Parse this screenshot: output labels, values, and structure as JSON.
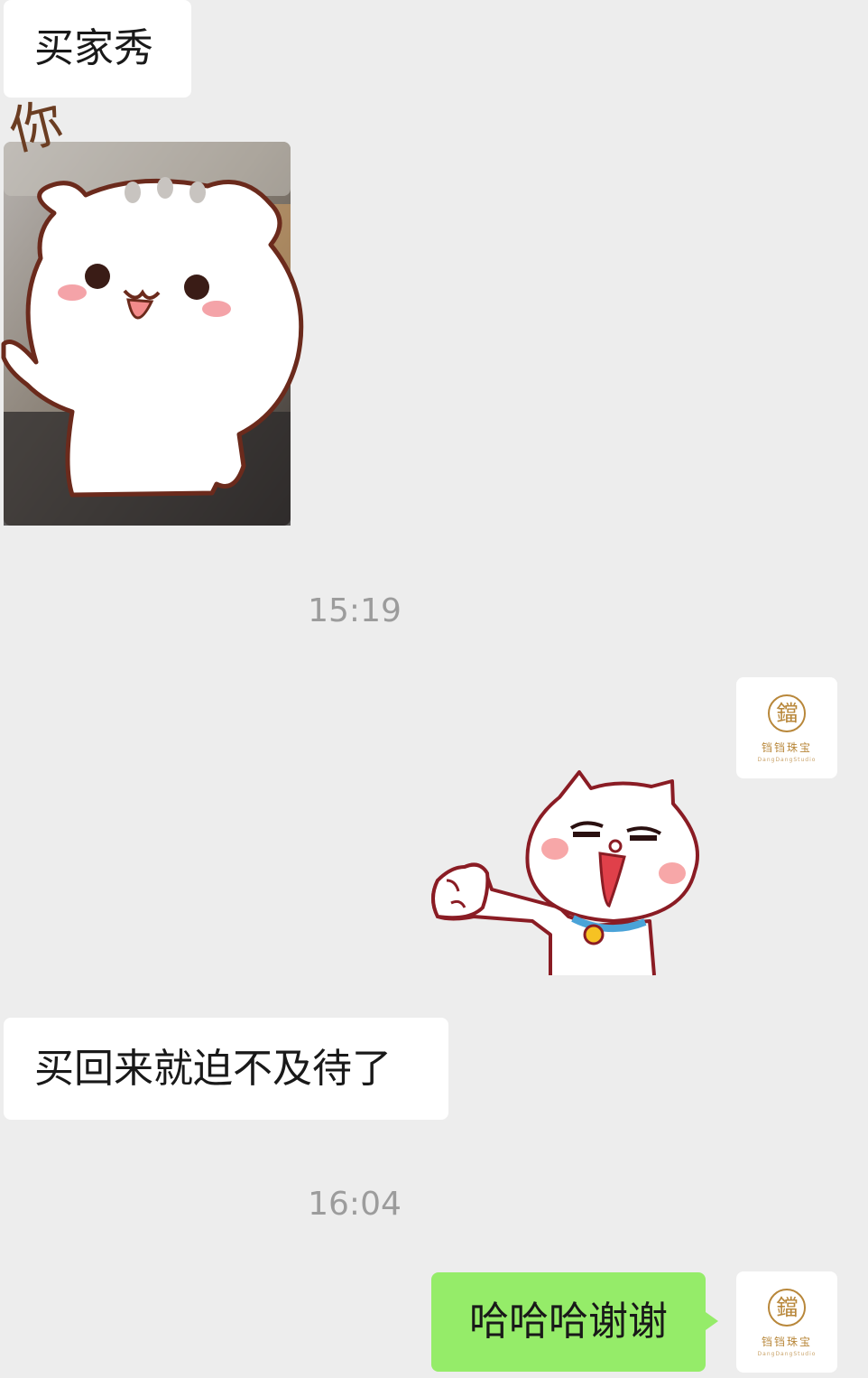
{
  "messages": {
    "left_1": "买家秀",
    "left_2": "买回来就迫不及待了",
    "right_1": "哈哈哈谢谢"
  },
  "timestamps": {
    "t1": "15:19",
    "t2": "16:04"
  },
  "sticker_text": "你",
  "avatar": {
    "brand": "铛铛珠宝",
    "brand_en": "DangDangStudio",
    "logo_glyph": "鐺"
  },
  "colors": {
    "background": "#ededed",
    "left_bubble": "#ffffff",
    "right_bubble": "#95ec69",
    "timestamp": "#9c9c9c",
    "brand_gold": "#b8873a"
  }
}
